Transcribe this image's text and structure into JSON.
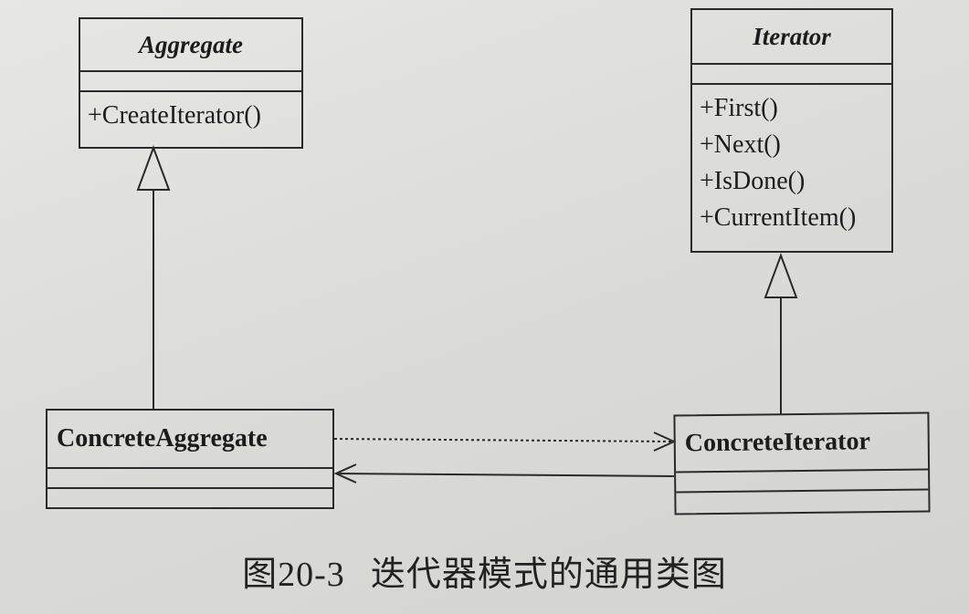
{
  "classes": {
    "aggregate": {
      "name": "Aggregate",
      "operations": [
        "+CreateIterator()"
      ]
    },
    "iterator": {
      "name": "Iterator",
      "operations": [
        "+First()",
        "+Next()",
        "+IsDone()",
        "+CurrentItem()"
      ]
    },
    "concrete_aggregate": {
      "name": "ConcreteAggregate"
    },
    "concrete_iterator": {
      "name": "ConcreteIterator"
    }
  },
  "caption": {
    "number": "图20-3",
    "text": "迭代器模式的通用类图"
  }
}
